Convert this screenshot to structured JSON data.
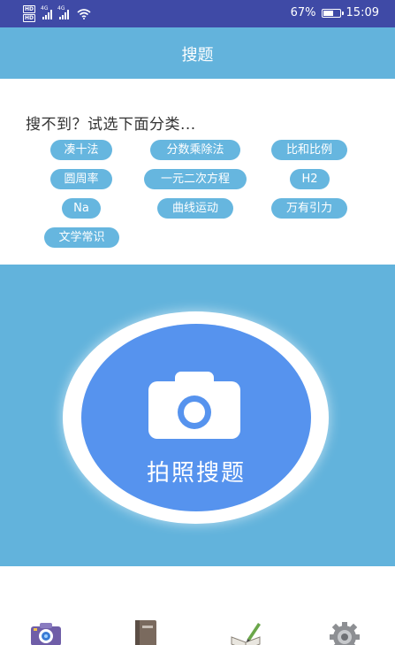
{
  "status_bar": {
    "hd_badges": [
      "HD",
      "HD"
    ],
    "network": [
      "4G",
      "4G"
    ],
    "battery_percent_text": "67%",
    "battery_level": 0.67,
    "time": "15:09"
  },
  "header": {
    "title": "搜题"
  },
  "categories": {
    "hint": "搜不到？试选下面分类...",
    "chips": [
      "凑十法",
      "分数乘除法",
      "比和比例",
      "圆周率",
      "一元二次方程",
      "H2",
      "Na",
      "曲线运动",
      "万有引力",
      "文学常识"
    ]
  },
  "main": {
    "camera_button_label": "拍照搜题"
  },
  "bottom_nav": {
    "icons": [
      "camera-icon",
      "book-icon",
      "notebook-pen-icon",
      "settings-gear-icon"
    ]
  },
  "colors": {
    "status_bar": "#3f4aa6",
    "header": "#63b3dc",
    "chip": "#66b6df",
    "photo_area": "#62b3dc",
    "camera_disc": "#5693ee"
  }
}
